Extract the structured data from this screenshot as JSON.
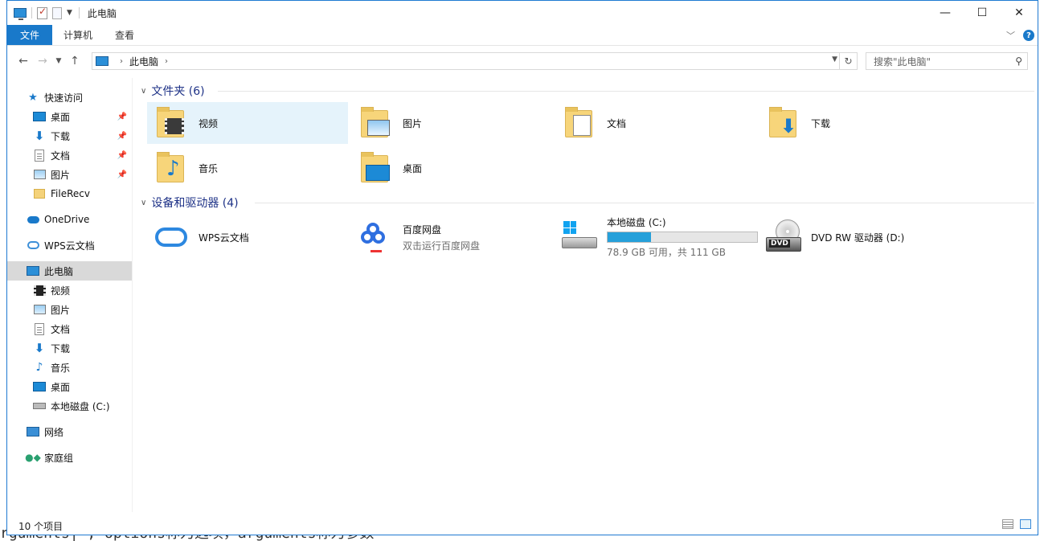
{
  "window": {
    "title": "此电脑",
    "controls": {
      "minimize": "—",
      "maximize": "☐",
      "close": "✕"
    }
  },
  "ribbon": {
    "tabs": [
      "文件",
      "计算机",
      "查看"
    ],
    "help": "?"
  },
  "address": {
    "crumb": "此电脑",
    "search_placeholder": "搜索\"此电脑\""
  },
  "nav_pane": [
    {
      "label": "快速访问",
      "icon": "star-icon"
    },
    {
      "label": "桌面",
      "icon": "desktop-icon",
      "pinned": true
    },
    {
      "label": "下载",
      "icon": "download-icon",
      "pinned": true
    },
    {
      "label": "文档",
      "icon": "document-icon",
      "pinned": true
    },
    {
      "label": "图片",
      "icon": "picture-icon",
      "pinned": true
    },
    {
      "label": "FileRecv",
      "icon": "folder-icon"
    },
    {
      "label": "OneDrive",
      "icon": "onedrive-icon"
    },
    {
      "label": "WPS云文档",
      "icon": "wps-cloud-icon"
    },
    {
      "label": "此电脑",
      "icon": "computer-icon",
      "selected": true
    },
    {
      "label": "视频",
      "icon": "video-icon"
    },
    {
      "label": "图片",
      "icon": "picture-icon"
    },
    {
      "label": "文档",
      "icon": "document-icon"
    },
    {
      "label": "下载",
      "icon": "download-icon"
    },
    {
      "label": "音乐",
      "icon": "music-icon"
    },
    {
      "label": "桌面",
      "icon": "desktop-icon"
    },
    {
      "label": "本地磁盘 (C:)",
      "icon": "disk-icon"
    },
    {
      "label": "网络",
      "icon": "network-icon"
    },
    {
      "label": "家庭组",
      "icon": "homegroup-icon"
    }
  ],
  "folders_group": {
    "header": "文件夹 (6)",
    "items": [
      {
        "label": "视频",
        "icon": "video-folder-icon"
      },
      {
        "label": "图片",
        "icon": "pictures-folder-icon"
      },
      {
        "label": "文档",
        "icon": "documents-folder-icon"
      },
      {
        "label": "下载",
        "icon": "downloads-folder-icon"
      },
      {
        "label": "音乐",
        "icon": "music-folder-icon"
      },
      {
        "label": "桌面",
        "icon": "desktop-folder-icon"
      }
    ]
  },
  "devices_group": {
    "header": "设备和驱动器 (4)",
    "items": [
      {
        "label": "WPS云文档",
        "icon": "wps-cloud-icon"
      },
      {
        "label": "百度网盘",
        "sub": "双击运行百度网盘",
        "icon": "baidu-netdisk-icon"
      },
      {
        "label": "本地磁盘 (C:)",
        "sub": "78.9 GB 可用，共 111 GB",
        "icon": "local-disk-icon",
        "used_fraction": 0.289
      },
      {
        "label": "DVD RW 驱动器 (D:)",
        "icon": "dvd-drive-icon",
        "badge": "DVD"
      }
    ]
  },
  "status": {
    "count": "10 个项目"
  },
  "background_text": "rguments| ; options称为选项，arguments称为参数"
}
